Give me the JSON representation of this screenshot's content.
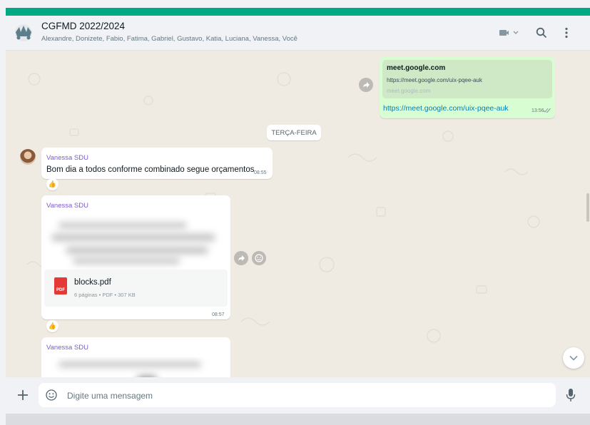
{
  "header": {
    "title": "CGFMD 2022/2024",
    "members": "Alexandre, Donizete, Fabio, Fatima, Gabriel, Gustavo, Katia, Luciana, Vanessa, Você",
    "icons": [
      "video-call-icon",
      "search-icon",
      "menu-icon"
    ]
  },
  "outgoing": {
    "preview_title": "meet.google.com",
    "preview_url": "https://meet.google.com/uix-pqee-auk",
    "preview_domain": "meet.google.com",
    "link_text": "https://meet.google.com/uix-pqee-auk",
    "time": "13:56"
  },
  "date_chip": "TERÇA-FEIRA",
  "messages": [
    {
      "sender": "Vanessa SDU",
      "text": "Bom dia a todos conforme combinado segue orçamentos",
      "time": "08:55",
      "reaction": "👍"
    },
    {
      "sender": "Vanessa SDU",
      "doc_name": "blocks.pdf",
      "doc_meta": "6 páginas • PDF • 307 KB",
      "doc_badge": "PDF",
      "time": "08:57",
      "reaction": "👍"
    },
    {
      "sender": "Vanessa SDU"
    }
  ],
  "composer": {
    "placeholder": "Digite uma mensagem"
  },
  "colors": {
    "accent": "#00a884",
    "outgoing_bubble": "#d9fdd3",
    "chat_background": "#efeae2",
    "sender_name": "#7a5bcd",
    "link": "#027eb5"
  }
}
